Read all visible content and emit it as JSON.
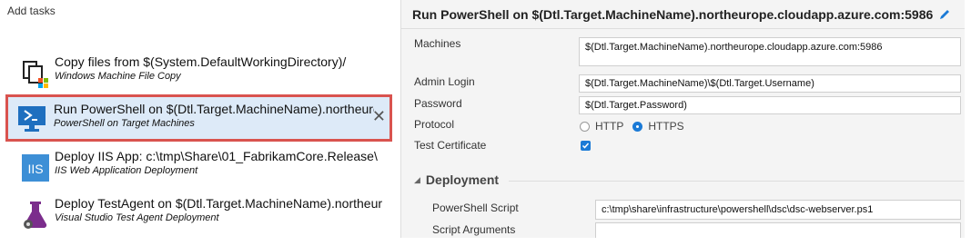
{
  "left": {
    "header": "Add tasks",
    "tasks": [
      {
        "title": "Copy files from $(System.DefaultWorkingDirectory)/",
        "subtitle": "Windows Machine File Copy",
        "icon": "copy-files-icon"
      },
      {
        "title": "Run PowerShell on $(Dtl.Target.MachineName).northeuro",
        "subtitle": "PowerShell on Target Machines",
        "icon": "powershell-icon",
        "selected": true
      },
      {
        "title": "Deploy IIS App: c:\\tmp\\Share\\01_FabrikamCore.Release\\",
        "subtitle": "IIS Web Application Deployment",
        "icon": "iis-icon"
      },
      {
        "title": "Deploy TestAgent on $(Dtl.Target.MachineName).northeur",
        "subtitle": "Visual Studio Test Agent Deployment",
        "icon": "test-agent-icon"
      }
    ],
    "close_glyph": "✕"
  },
  "right": {
    "title": "Run PowerShell on $(Dtl.Target.MachineName).northeurope.cloudapp.azure.com:5986",
    "machines_label": "Machines",
    "machines_value": "$(Dtl.Target.MachineName).northeurope.cloudapp.azure.com:5986",
    "admin_login_label": "Admin Login",
    "admin_login_value": "$(Dtl.Target.MachineName)\\$(Dtl.Target.Username)",
    "password_label": "Password",
    "password_value": "$(Dtl.Target.Password)",
    "protocol_label": "Protocol",
    "protocol_options": [
      "HTTP",
      "HTTPS"
    ],
    "protocol_selected": "HTTPS",
    "test_cert_label": "Test Certificate",
    "test_cert_checked": true,
    "deployment_section": "Deployment",
    "ps_script_label": "PowerShell Script",
    "ps_script_value": "c:\\tmp\\share\\infrastructure\\powershell\\dsc\\dsc-webserver.ps1",
    "script_args_label": "Script Arguments"
  },
  "colors": {
    "accent": "#1b7ad6",
    "selection_bg": "#ddeaf8",
    "selection_border": "#d9534f"
  }
}
